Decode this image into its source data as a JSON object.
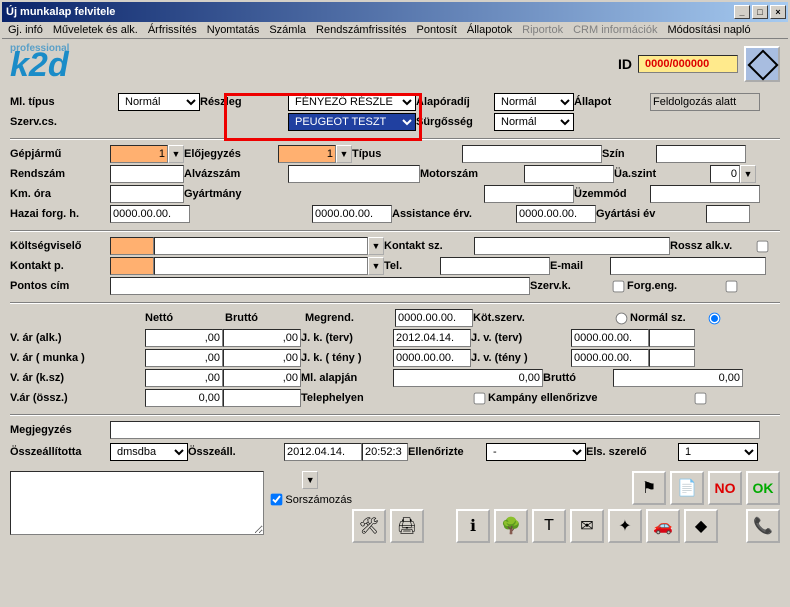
{
  "window": {
    "title": "Új munkalap felvitele"
  },
  "menu": {
    "items": [
      "Gj. infó",
      "Műveletek és alk.",
      "Árfrissítés",
      "Nyomtatás",
      "Számla",
      "Rendszámfrissítés",
      "Pontosít",
      "Állapotok",
      "Riportok",
      "CRM információk",
      "Módosítási napló"
    ],
    "disabled_index": [
      8,
      9
    ]
  },
  "logo": {
    "tagline": "professional",
    "brand": "k2d"
  },
  "id": {
    "label": "ID",
    "value": "0000/000000"
  },
  "topSelects": {
    "ml_tipus_label": "Ml. típus",
    "ml_tipus": "Normál",
    "reszleg_label": "Részleg",
    "reszleg": "FÉNYEZŐ RÉSZLE",
    "alaporadij_label": "Alapóradíj",
    "alaporadij": "Normál",
    "allapot_label": "Állapot",
    "allapot": "Feldolgozás alatt",
    "szervcs_label": "Szerv.cs.",
    "szervcs": "PEUGEOT TESZT",
    "surgosseg_label": "Sürgősség",
    "surgosseg": "Normál"
  },
  "vehicle": {
    "gepjarmu_label": "Gépjármű",
    "gepjarmu": "1",
    "elojegyzes_label": "Előjegyzés",
    "elojegyzes": "1",
    "tipus_label": "Típus",
    "tipus": "",
    "szin_label": "Szín",
    "szin": "",
    "rendszam_label": "Rendszám",
    "rendszam": "",
    "alvazszam_label": "Alvázszám",
    "alvazszam": "",
    "motorszam_label": "Motorszám",
    "motorszam": "",
    "uaszint_label": "Üa.szint",
    "uaszint": "0",
    "kmora_label": "Km. óra",
    "kmora": "",
    "gyartmany_label": "Gyártmány",
    "gyartmany": "",
    "uzemmod_label": "Üzemmód",
    "uzemmod": "",
    "hazaiforg_label": "Hazai forg. h.",
    "hazaiforg": "0000.00.00.",
    "hazaiforg2": "0000.00.00.",
    "assistance_label": "Assistance érv.",
    "assistance": "0000.00.00.",
    "gyartasiev_label": "Gyártási év",
    "gyartasiev": ""
  },
  "contact": {
    "koltsegviselo_label": "Költségviselő",
    "koltsegviselo": "",
    "kontaktsz_label": "Kontakt sz.",
    "kontaktsz": "",
    "rosszalk_label": "Rossz alk.v.",
    "kontaktp_label": "Kontakt p.",
    "kontaktp": "",
    "tel_label": "Tel.",
    "tel": "",
    "email_label": "E-mail",
    "email": "",
    "pontoscim_label": "Pontos cím",
    "pontoscim": "",
    "szervk_label": "Szerv.k.",
    "forgeng_label": "Forg.eng."
  },
  "pricing": {
    "netto_label": "Nettó",
    "brutto_label": "Bruttó",
    "v_ar_alk_label": "V. ár (alk.)",
    "v_ar_alk_n": ",00",
    "v_ar_alk_b": ",00",
    "v_ar_munka_label": "V. ár ( munka )",
    "v_ar_munka_n": ",00",
    "v_ar_munka_b": ",00",
    "v_ar_ksz_label": "V. ár (k.sz)",
    "v_ar_ksz_n": ",00",
    "v_ar_ksz_b": ",00",
    "v_ar_ossz_label": "V.ár (össz.)",
    "v_ar_ossz_n": "0,00",
    "v_ar_ossz_b": "",
    "megrend_label": "Megrend.",
    "megrend": "0000.00.00.",
    "jk_terv_label": "J. k. (terv)",
    "jk_terv": "2012.04.14.",
    "jk_teny_label": "J. k. ( tény )",
    "jk_teny": "0000.00.00.",
    "ml_alapjan_label": "Ml. alapján",
    "ml_alapjan": "0,00",
    "jv_terv_label": "J. v. (terv)",
    "jv_terv": "0000.00.00.",
    "jv_teny_label": "J. v. (tény )",
    "jv_teny": "0000.00.00.",
    "brutto2_label": "Bruttó",
    "brutto2": "0,00",
    "kotszerv_label": "Köt.szerv.",
    "normalsz_label": "Normál sz.",
    "telephelyen_label": "Telephelyen",
    "kampany_label": "Kampány ellenőrizve"
  },
  "bottom": {
    "megjegyzes_label": "Megjegyzés",
    "megjegyzes": "",
    "osszeall_label": "Összeállította",
    "osszeall": "dmsdba",
    "osszeall_date_label": "Összeáll.",
    "osszeall_date": "2012.04.14.",
    "osszeall_time": "20:52:3",
    "ellenorizte_label": "Ellenőrizte",
    "ellenorizte": "-",
    "elsszerelo_label": "Els. szerelő",
    "elsszerelo": "1",
    "sorszamozas_label": "Sorszámozás"
  },
  "buttons": {
    "no": "NO",
    "ok": "OK"
  }
}
